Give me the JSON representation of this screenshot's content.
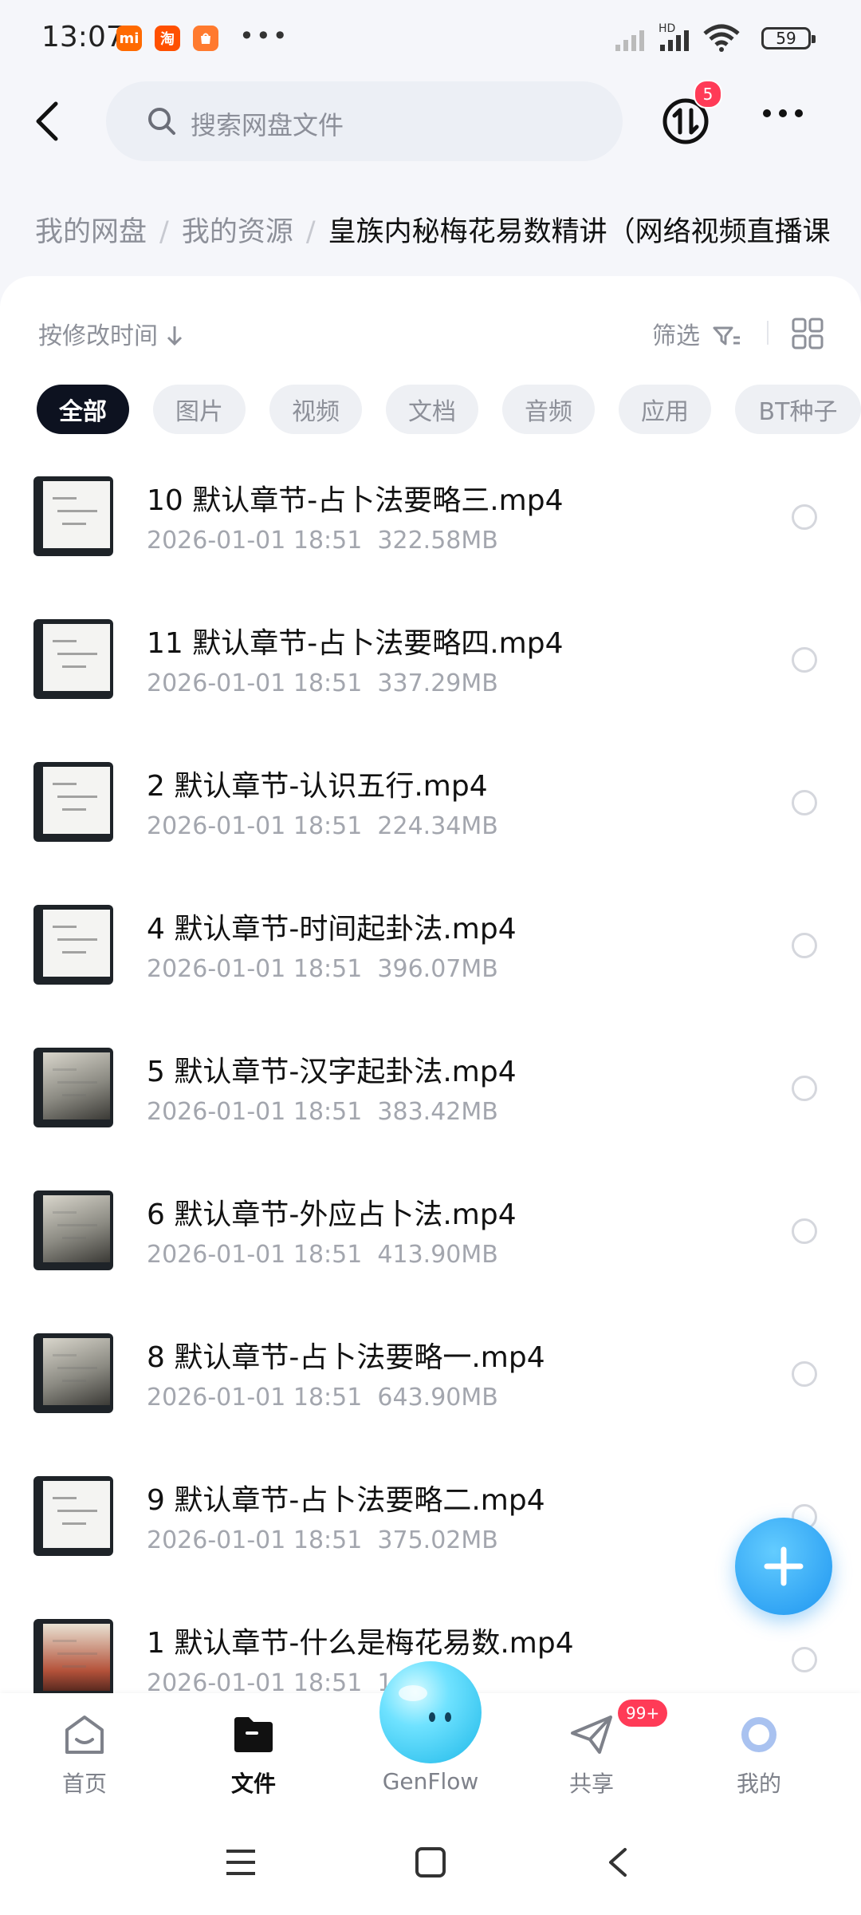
{
  "status_bar": {
    "time": "13:07",
    "battery": "59",
    "signal_label": "HD",
    "overflow": "•••"
  },
  "header": {
    "search_placeholder": "搜索网盘文件",
    "transfer_badge": "5"
  },
  "breadcrumb": [
    "我的网盘",
    "我的资源",
    "皇族内秘梅花易数精讲（网络视频直播课"
  ],
  "toolbar": {
    "sort_label": "按修改时间",
    "filter_label": "筛选"
  },
  "chips": [
    "全部",
    "图片",
    "视频",
    "文档",
    "音频",
    "应用",
    "BT种子"
  ],
  "files": [
    {
      "name": "10 默认章节-占卜法要略三.mp4",
      "date": "2026-01-01  18:51",
      "size": "322.58MB"
    },
    {
      "name": "11 默认章节-占卜法要略四.mp4",
      "date": "2026-01-01  18:51",
      "size": "337.29MB"
    },
    {
      "name": "2 默认章节-认识五行.mp4",
      "date": "2026-01-01  18:51",
      "size": "224.34MB"
    },
    {
      "name": "4 默认章节-时间起卦法.mp4",
      "date": "2026-01-01  18:51",
      "size": "396.07MB"
    },
    {
      "name": "5 默认章节-汉字起卦法.mp4",
      "date": "2026-01-01  18:51",
      "size": "383.42MB"
    },
    {
      "name": "6 默认章节-外应占卜法.mp4",
      "date": "2026-01-01  18:51",
      "size": "413.90MB"
    },
    {
      "name": "8 默认章节-占卜法要略一.mp4",
      "date": "2026-01-01  18:51",
      "size": "643.90MB"
    },
    {
      "name": "9 默认章节-占卜法要略二.mp4",
      "date": "2026-01-01  18:51",
      "size": "375.02MB"
    },
    {
      "name": "1 默认章节-什么是梅花易数.mp4",
      "date": "2026-01-01  18:51",
      "size": "1"
    }
  ],
  "bottom_nav": {
    "items": [
      "首页",
      "文件",
      "GenFlow",
      "共享",
      "我的"
    ],
    "share_badge": "99+"
  },
  "colors": {
    "accent": "#1e95f0",
    "badge": "#ff3b57",
    "chip_active": "#0d1220"
  }
}
